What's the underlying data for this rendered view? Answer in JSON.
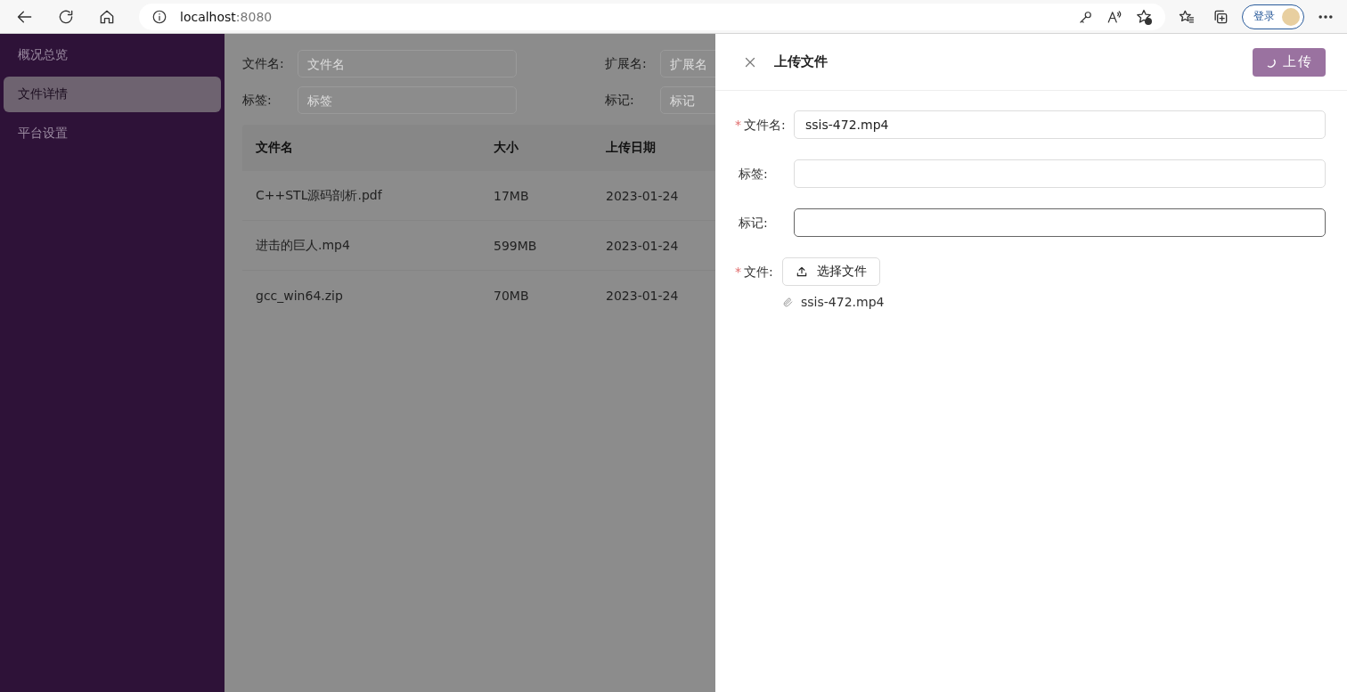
{
  "browser": {
    "url_host": "localhost",
    "url_port": ":8080",
    "login_label": "登录"
  },
  "sidebar": {
    "items": [
      {
        "label": "概况总览",
        "selected": false
      },
      {
        "label": "文件详情",
        "selected": true
      },
      {
        "label": "平台设置",
        "selected": false
      }
    ]
  },
  "filters": [
    {
      "label": "文件名:",
      "placeholder": "文件名"
    },
    {
      "label": "扩展名:",
      "placeholder": "扩展名"
    },
    {
      "label": "标签:",
      "placeholder": "标签"
    },
    {
      "label": "标记:",
      "placeholder": "标记"
    }
  ],
  "table": {
    "columns": [
      "文件名",
      "大小",
      "上传日期"
    ],
    "rows": [
      [
        "C++STL源码剖析.pdf",
        "17MB",
        "2023-01-24"
      ],
      [
        "进击的巨人.mp4",
        "599MB",
        "2023-01-24"
      ],
      [
        "gcc_win64.zip",
        "70MB",
        "2023-01-24"
      ]
    ]
  },
  "drawer": {
    "title": "上传文件",
    "required_mark": "*",
    "submit": {
      "label": "上传",
      "loading": true
    },
    "fields": [
      {
        "kind": "text",
        "label": "文件名:",
        "required": true,
        "value": "ssis-472.mp4",
        "focused": false
      },
      {
        "kind": "text",
        "label": "标签:",
        "required": false,
        "focused": false
      },
      {
        "kind": "text",
        "label": "标记:",
        "required": false,
        "focused": true
      },
      {
        "kind": "upload",
        "label": "文件:",
        "required": true,
        "button": "选择文件",
        "files": [
          "ssis-472.mp4"
        ]
      }
    ]
  }
}
